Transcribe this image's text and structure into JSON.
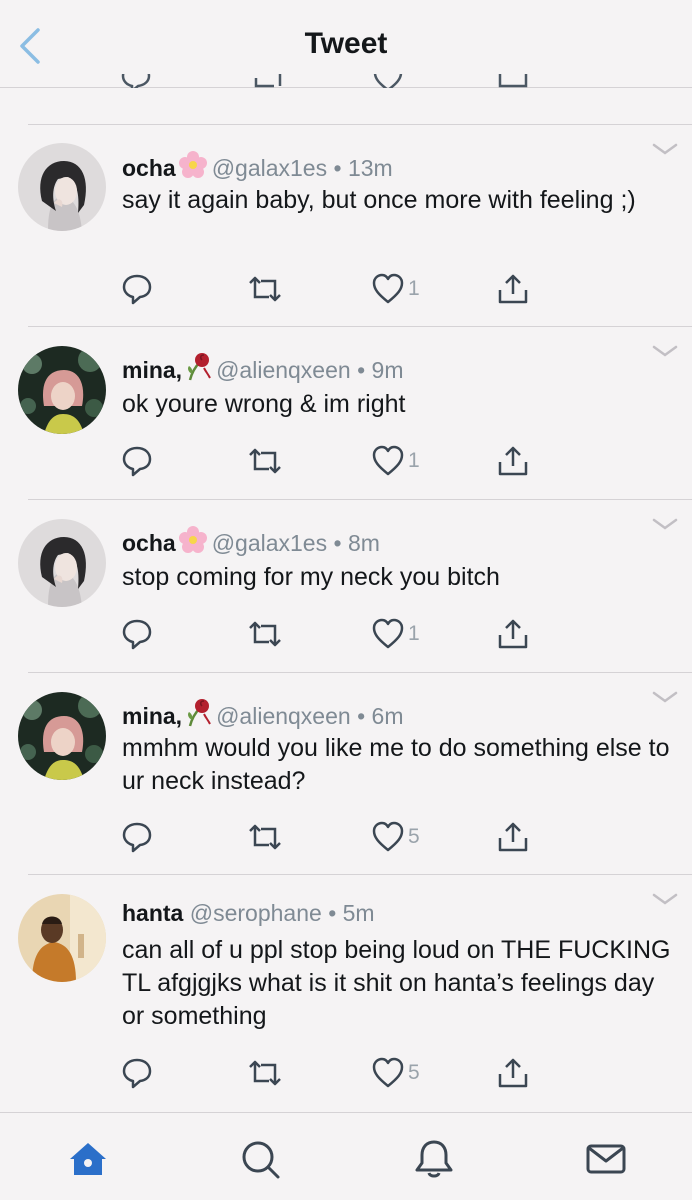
{
  "header": {
    "title": "Tweet",
    "back_icon": "chevron-left-icon"
  },
  "tweets": [
    {
      "name": "ocha",
      "emoji": "cherry-blossom",
      "handle": "@galax1es",
      "sep": "•",
      "time": "13m",
      "body": "say it again baby, but once more with feeling ;)",
      "likes": "1"
    },
    {
      "name": "mina,",
      "emoji": "wilted-rose",
      "handle": "@alienqxeen",
      "sep": "•",
      "time": "9m",
      "body": "ok youre wrong & im right",
      "likes": "1"
    },
    {
      "name": "ocha",
      "emoji": "cherry-blossom",
      "handle": "@galax1es",
      "sep": "•",
      "time": "8m",
      "body": "stop coming for my neck you bitch",
      "likes": "1"
    },
    {
      "name": "mina,",
      "emoji": "wilted-rose",
      "handle": "@alienqxeen",
      "sep": "•",
      "time": "6m",
      "body": "mmhm would you like me to do something else to ur neck instead?",
      "likes": "5"
    },
    {
      "name": "hanta",
      "emoji": "",
      "handle": "@serophane",
      "sep": "•",
      "time": "5m",
      "body": "can all of u ppl stop being loud on THE FUCKING TL afgjgjks what is it shit on hanta’s feelings day or something",
      "likes": "5"
    }
  ],
  "tabbar": {
    "icons": [
      "home-icon",
      "search-icon",
      "notifications-icon",
      "messages-icon"
    ]
  },
  "colors": {
    "accent": "#1da1f2",
    "text": "#14171a",
    "secondary": "#7f8a94",
    "background": "#f5f3f4",
    "divider": "#d5d2d5"
  }
}
